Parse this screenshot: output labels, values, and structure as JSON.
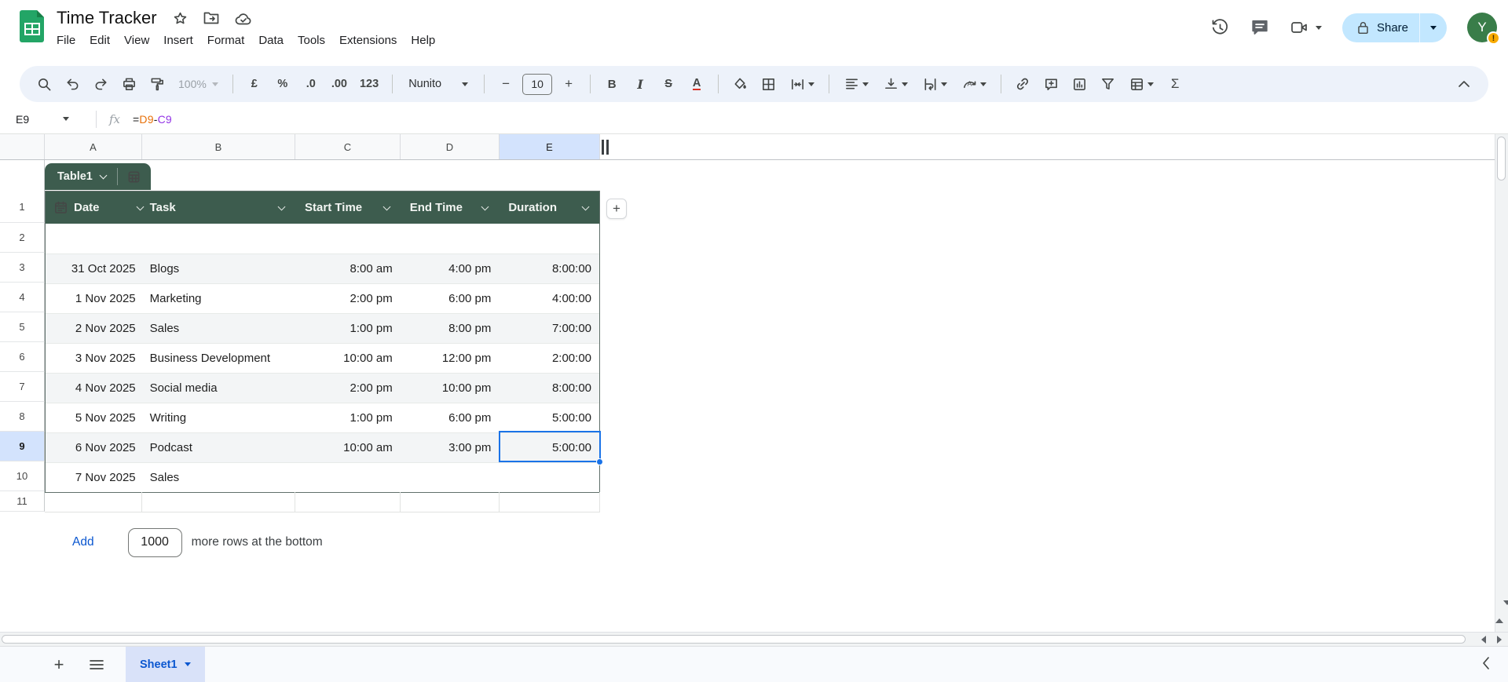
{
  "titlebar": {
    "title": "Time Tracker",
    "menus": [
      "File",
      "Edit",
      "View",
      "Insert",
      "Format",
      "Data",
      "Tools",
      "Extensions",
      "Help"
    ],
    "share_label": "Share",
    "avatar_initial": "Y",
    "avatar_badge": "!"
  },
  "toolbar": {
    "zoom_level": "100%",
    "font_name": "Nunito",
    "font_size": "10",
    "currency": "£",
    "percent": "%",
    "decrease_decimal": ".0",
    "increase_decimal": ".00",
    "number_format": "123",
    "bold": "B",
    "italic": "I",
    "strikethrough": "S",
    "text_color": "A",
    "minus": "−",
    "plus": "+",
    "functions": "Σ"
  },
  "formula_bar": {
    "cell_ref": "E9",
    "fx_label": "fx",
    "formula": "=D9-C9",
    "parts": {
      "eq": "=",
      "ref1": "D9",
      "minus": "-",
      "ref2": "C9"
    }
  },
  "grid": {
    "columns": [
      "A",
      "B",
      "C",
      "D",
      "E"
    ],
    "row_numbers": [
      "1",
      "2",
      "3",
      "4",
      "5",
      "6",
      "7",
      "8",
      "9",
      "10",
      "11"
    ],
    "selected_cell": "E9",
    "add_column_label": "+"
  },
  "table": {
    "name": "Table1",
    "headers": [
      "Date",
      "Task",
      "Start Time",
      "End Time",
      "Duration"
    ],
    "rows": [
      [
        "",
        "",
        "",
        "",
        ""
      ],
      [
        "31 Oct 2025",
        "Blogs",
        "8:00 am",
        "4:00 pm",
        "8:00:00"
      ],
      [
        "1 Nov 2025",
        "Marketing",
        "2:00 pm",
        "6:00 pm",
        "4:00:00"
      ],
      [
        "2 Nov 2025",
        "Sales",
        "1:00 pm",
        "8:00 pm",
        "7:00:00"
      ],
      [
        "3 Nov 2025",
        "Business Development",
        "10:00 am",
        "12:00 pm",
        "2:00:00"
      ],
      [
        "4 Nov 2025",
        "Social media",
        "2:00 pm",
        "10:00 pm",
        "8:00:00"
      ],
      [
        "5 Nov 2025",
        "Writing",
        "1:00 pm",
        "6:00 pm",
        "5:00:00"
      ],
      [
        "6 Nov 2025",
        "Podcast",
        "10:00 am",
        "3:00 pm",
        "5:00:00"
      ],
      [
        "7 Nov 2025",
        "Sales",
        "",
        "",
        ""
      ]
    ]
  },
  "add_rows": {
    "add_label": "Add",
    "count": "1000",
    "suffix": "more rows at the bottom"
  },
  "bottom_bar": {
    "sheet_tab": "Sheet1"
  },
  "colors": {
    "accent_blue": "#1a73e8",
    "table_green": "#3d5c4e",
    "selection_highlight": "#d3e3fd",
    "share_pill": "#c2e7ff",
    "toolbar_pill": "#edf2fa",
    "ref_orange": "#e8710a",
    "ref_purple": "#9334e6",
    "link_blue": "#0b57d0",
    "sheet_logo_green": "#23a566"
  }
}
